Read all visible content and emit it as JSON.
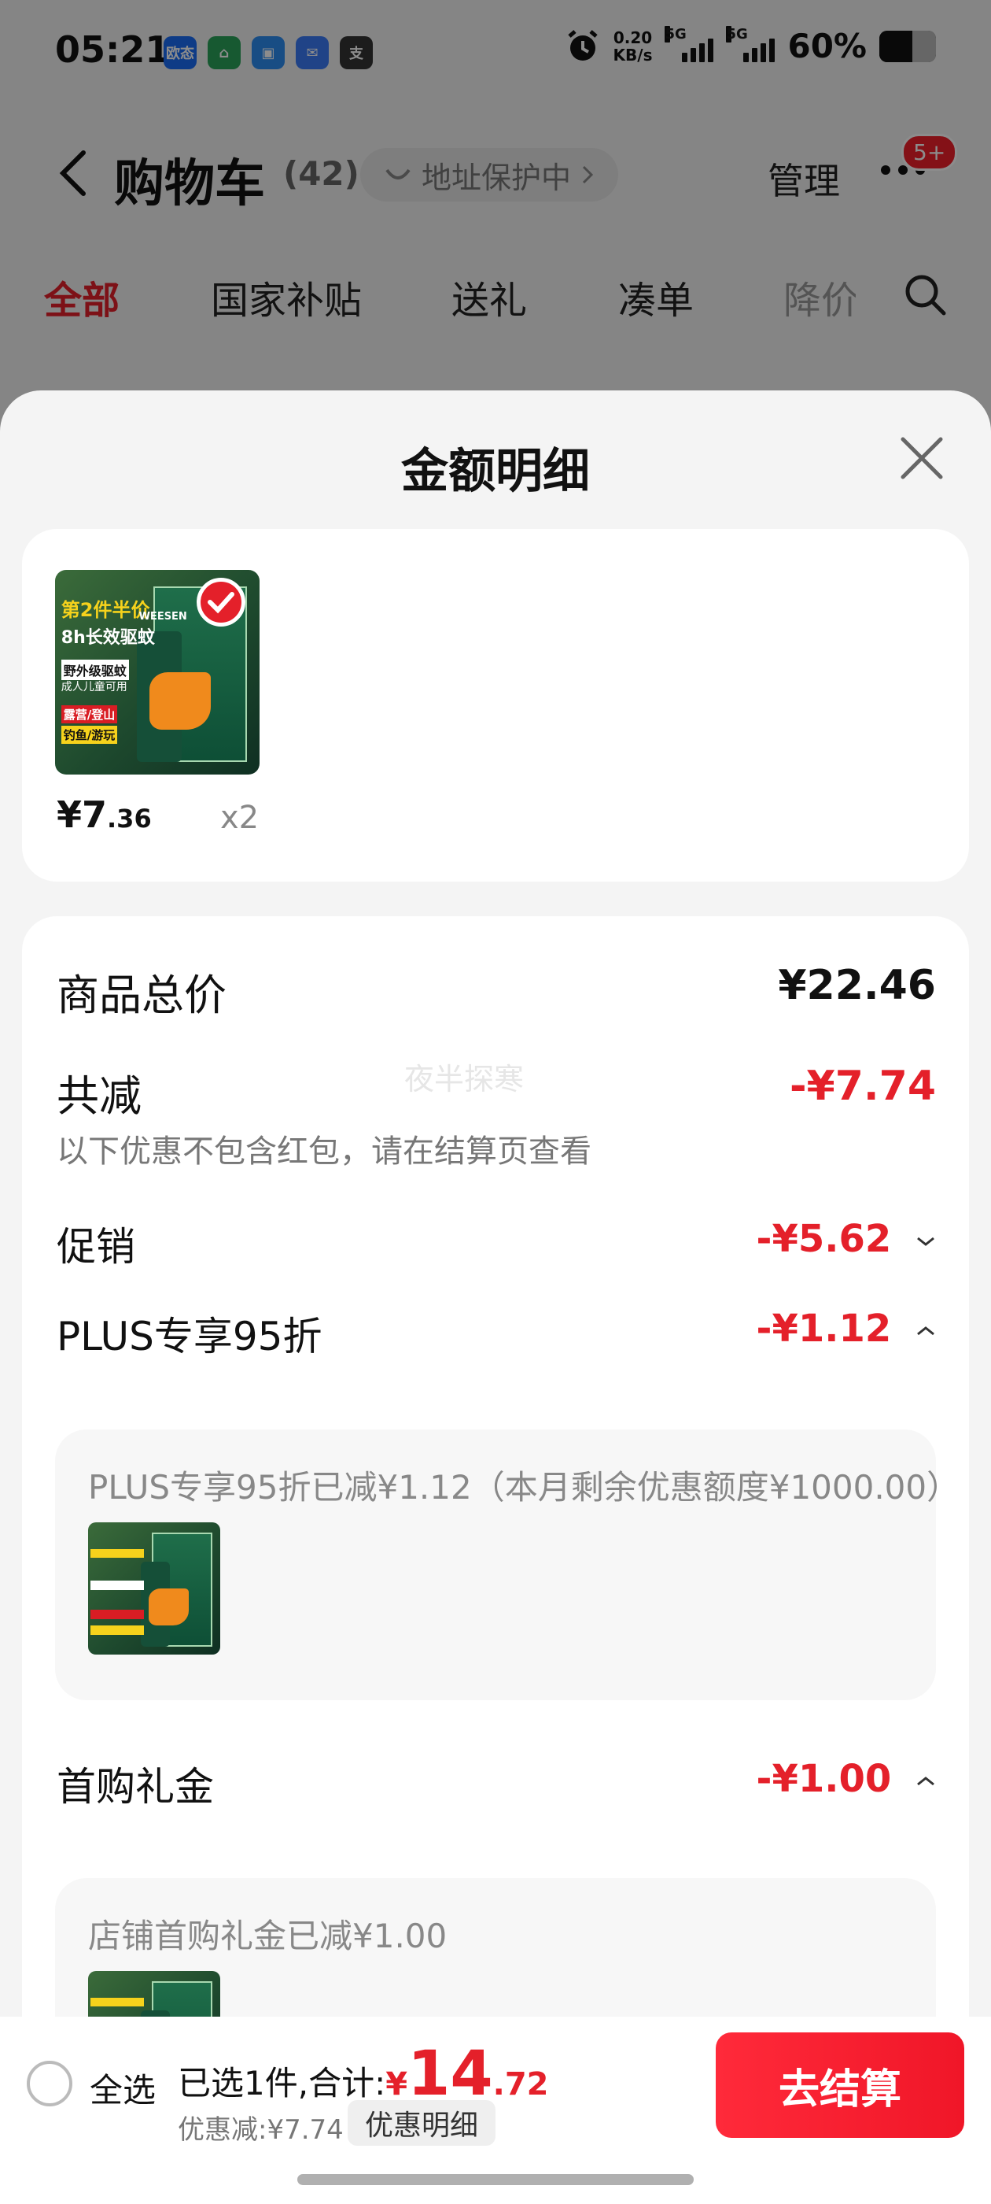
{
  "status_bar": {
    "time": "05:21",
    "apps": [
      {
        "icon": "app-oushi-icon",
        "label": "欧态",
        "color": "#1b6cf5"
      },
      {
        "icon": "app-home-icon",
        "label": "⌂",
        "color": "#2aa35a"
      },
      {
        "icon": "app-box-icon",
        "label": "▣",
        "color": "#2d8cf0"
      },
      {
        "icon": "app-mail-icon",
        "label": "✉",
        "color": "#3b7bf6"
      },
      {
        "icon": "app-pay-icon",
        "label": "支",
        "color": "#333333"
      }
    ],
    "net_speed_value": "0.20",
    "net_speed_unit": "KB/s",
    "sim1": "5G",
    "sim2": "5G",
    "battery": "60%",
    "battery_level": 0.6
  },
  "cart": {
    "title": "购物车",
    "count": "(42)",
    "address_protect": "地址保护中",
    "manage": "管理",
    "message_badge": "5+",
    "tabs": [
      {
        "label": "全部",
        "active": true
      },
      {
        "label": "国家补贴",
        "active": false
      },
      {
        "label": "送礼",
        "active": false
      },
      {
        "label": "凑单",
        "active": false
      },
      {
        "label": "降价",
        "active": false
      }
    ]
  },
  "sheet": {
    "title": "金额明细",
    "product": {
      "price_int": "¥7",
      "price_dec": ".36",
      "qty": "x2",
      "promo": {
        "line1": "第2件半价",
        "line2": "8h长效驱蚊",
        "line3": "野外级驱蚊",
        "line4": "成人儿童可用",
        "line5": "露营/登山",
        "line6": "钓鱼/游玩",
        "brand": "WEESEN"
      }
    },
    "total_label": "商品总价",
    "total_value": "¥22.46",
    "reduce_label": "共减",
    "reduce_value": "-¥7.74",
    "reduce_note": "以下优惠不包含红包，请在结算页查看",
    "watermark": "夜半探寒",
    "promo_label": "促销",
    "promo_value": "-¥5.62",
    "plus_label": "PLUS专享95折",
    "plus_value": "-¥1.12",
    "plus_detail": "PLUS专享95折已减¥1.12（本月剩余优惠额度¥1000.00）",
    "first_label": "首购礼金",
    "first_value": "-¥1.00",
    "first_detail": "店铺首购礼金已减¥1.00"
  },
  "bottom_bar": {
    "select_all": "全选",
    "selected_text": "已选1件,合计:",
    "total_yuan": "¥",
    "total_int": "14",
    "total_dec": ".72",
    "saved": "优惠减:¥7.74",
    "detail_button": "优惠明细",
    "checkout": "去结算"
  },
  "colors": {
    "accent_red": "#e4202a",
    "overlay": "rgba(0,0,0,0.45)"
  }
}
